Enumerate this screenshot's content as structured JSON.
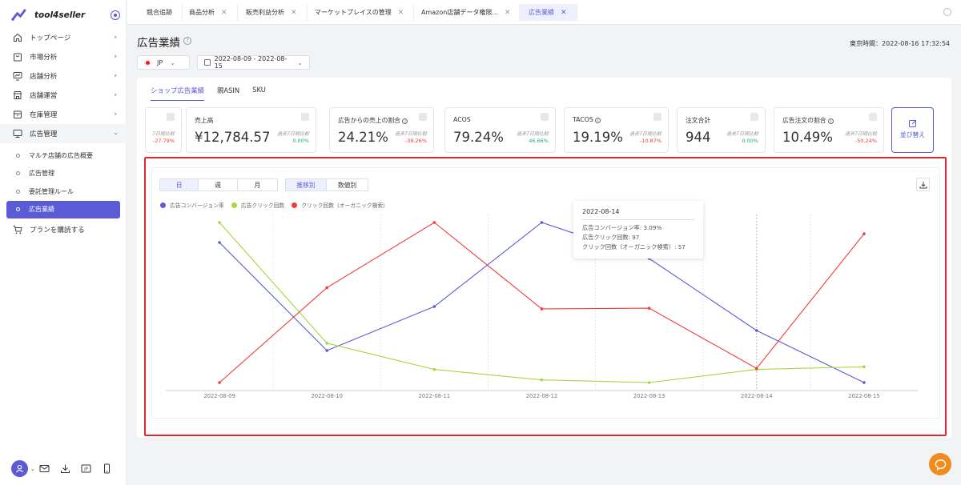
{
  "app": {
    "name": "tool4seller"
  },
  "sidebar": {
    "items": [
      {
        "label": "トップページ",
        "icon": "home-icon"
      },
      {
        "label": "市場分析",
        "icon": "bag-icon"
      },
      {
        "label": "店舗分析",
        "icon": "monitor-chart-icon"
      },
      {
        "label": "店舗運営",
        "icon": "store-icon"
      },
      {
        "label": "在庫管理",
        "icon": "box-icon"
      },
      {
        "label": "広告管理",
        "icon": "screen-icon"
      }
    ],
    "sub_items": [
      {
        "label": "マルチ店舗の広告概要"
      },
      {
        "label": "広告管理"
      },
      {
        "label": "委託管理ルール"
      },
      {
        "label": "広告業績"
      }
    ],
    "plan_label": "プランを購読する"
  },
  "tabs": [
    {
      "label": "競合追跡",
      "closable": false
    },
    {
      "label": "商品分析",
      "closable": true
    },
    {
      "label": "販売利益分析",
      "closable": true
    },
    {
      "label": "マーケットプレイスの管理",
      "closable": true
    },
    {
      "label": "Amazon店舗データ権限...",
      "closable": true
    },
    {
      "label": "広告業績",
      "closable": true,
      "active": true
    }
  ],
  "page": {
    "title": "広告業績",
    "server_time": "東京時間：2022-08-16 17:32:54",
    "marketplace": "JP",
    "date_range": "2022-08-09 - 2022-08-15"
  },
  "subtabs": [
    "ショップ広告業績",
    "親ASIN",
    "SKU"
  ],
  "kpis": [
    {
      "label": "",
      "value": "",
      "compare_label": "7日間比較",
      "compare_value": "-27.79%",
      "trend": "down"
    },
    {
      "label": "売上高",
      "value": "¥12,784.57",
      "compare_label": "過去7日間比較",
      "compare_value": "0.00%",
      "trend": "up"
    },
    {
      "label": "広告からの売上の割合",
      "value": "24.21%",
      "compare_label": "過去7日間比較",
      "compare_value": "-39.26%",
      "trend": "down",
      "info": true
    },
    {
      "label": "ACOS",
      "value": "79.24%",
      "compare_label": "過去7日間比較",
      "compare_value": "46.66%",
      "trend": "up"
    },
    {
      "label": "TACOS",
      "value": "19.19%",
      "compare_label": "過去7日間比較",
      "compare_value": "-10.87%",
      "trend": "down",
      "info": true
    },
    {
      "label": "注文合計",
      "value": "944",
      "compare_label": "過去7日間比較",
      "compare_value": "0.00%",
      "trend": "up"
    },
    {
      "label": "広告注文の割合",
      "value": "10.49%",
      "compare_label": "過去7日間比較",
      "compare_value": "-50.24%",
      "trend": "down",
      "info": true
    }
  ],
  "sort_button": "並び替え",
  "period_toggle": [
    "日",
    "週",
    "月"
  ],
  "view_toggle": [
    "推移別",
    "数値別"
  ],
  "chart_data": {
    "type": "line",
    "x": [
      "2022-08-09",
      "2022-08-10",
      "2022-08-11",
      "2022-08-12",
      "2022-08-13",
      "2022-08-14",
      "2022-08-15"
    ],
    "series": [
      {
        "name": "広告コンバージョン率",
        "color": "#5b5bd6",
        "values": [
          4.1,
          1.4,
          2.5,
          4.6,
          3.7,
          1.9,
          0.6
        ]
      },
      {
        "name": "広告クリック回数",
        "color": "#a8d63f",
        "values": [
          132,
          109,
          104,
          102,
          101.5,
          104,
          104.5
        ]
      },
      {
        "name": "クリック回数（オーガニック検索）",
        "color": "#f23b3b",
        "values": [
          0,
          67,
          113,
          52,
          52.5,
          10,
          105
        ]
      }
    ],
    "grid": "vertical-dashed",
    "legend": "top-left",
    "tooltip": {
      "date": "2022-08-14",
      "lines": [
        "広告コンバージョン率: 3.09%",
        "広告クリック回数: 97",
        "クリック回数（オーガニック検索）: 57"
      ]
    }
  }
}
